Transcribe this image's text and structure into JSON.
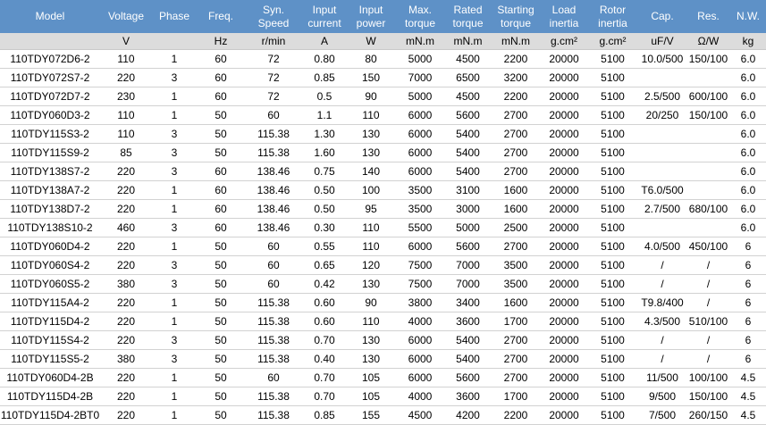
{
  "header": {
    "columns": [
      "Model",
      "Voltage",
      "Phase",
      "Freq.",
      "Syn.\nSpeed",
      "Input\ncurrent",
      "Input\npower",
      "Max.\ntorque",
      "Rated\ntorque",
      "Starting\ntorque",
      "Load\ninertia",
      "Rotor\ninertia",
      "Cap.",
      "Res.",
      "N.W."
    ],
    "units": [
      "",
      "V",
      "",
      "Hz",
      "r/min",
      "A",
      "W",
      "mN.m",
      "mN.m",
      "mN.m",
      "g.cm²",
      "g.cm²",
      "uF/V",
      "Ω/W",
      "kg"
    ]
  },
  "rows": [
    [
      "110TDY072D6-2",
      "110",
      "1",
      "60",
      "72",
      "0.80",
      "80",
      "5000",
      "4500",
      "2200",
      "20000",
      "5100",
      "10.0/500",
      "150/100",
      "6.0"
    ],
    [
      "110TDY072S7-2",
      "220",
      "3",
      "60",
      "72",
      "0.85",
      "150",
      "7000",
      "6500",
      "3200",
      "20000",
      "5100",
      "",
      "",
      "6.0"
    ],
    [
      "110TDY072D7-2",
      "230",
      "1",
      "60",
      "72",
      "0.5",
      "90",
      "5000",
      "4500",
      "2200",
      "20000",
      "5100",
      "2.5/500",
      "600/100",
      "6.0"
    ],
    [
      "110TDY060D3-2",
      "110",
      "1",
      "50",
      "60",
      "1.1",
      "110",
      "6000",
      "5600",
      "2700",
      "20000",
      "5100",
      "20/250",
      "150/100",
      "6.0"
    ],
    [
      "110TDY115S3-2",
      "110",
      "3",
      "50",
      "115.38",
      "1.30",
      "130",
      "6000",
      "5400",
      "2700",
      "20000",
      "5100",
      "",
      "",
      "6.0"
    ],
    [
      "110TDY115S9-2",
      "85",
      "3",
      "50",
      "115.38",
      "1.60",
      "130",
      "6000",
      "5400",
      "2700",
      "20000",
      "5100",
      "",
      "",
      "6.0"
    ],
    [
      "110TDY138S7-2",
      "220",
      "3",
      "60",
      "138.46",
      "0.75",
      "140",
      "6000",
      "5400",
      "2700",
      "20000",
      "5100",
      "",
      "",
      "6.0"
    ],
    [
      "110TDY138A7-2",
      "220",
      "1",
      "60",
      "138.46",
      "0.50",
      "100",
      "3500",
      "3100",
      "1600",
      "20000",
      "5100",
      "T6.0/500",
      "",
      "6.0"
    ],
    [
      "110TDY138D7-2",
      "220",
      "1",
      "60",
      "138.46",
      "0.50",
      "95",
      "3500",
      "3000",
      "1600",
      "20000",
      "5100",
      "2.7/500",
      "680/100",
      "6.0"
    ],
    [
      "110TDY138S10-2",
      "460",
      "3",
      "60",
      "138.46",
      "0.30",
      "110",
      "5500",
      "5000",
      "2500",
      "20000",
      "5100",
      "",
      "",
      "6.0"
    ],
    [
      "110TDY060D4-2",
      "220",
      "1",
      "50",
      "60",
      "0.55",
      "110",
      "6000",
      "5600",
      "2700",
      "20000",
      "5100",
      "4.0/500",
      "450/100",
      "6"
    ],
    [
      "110TDY060S4-2",
      "220",
      "3",
      "50",
      "60",
      "0.65",
      "120",
      "7500",
      "7000",
      "3500",
      "20000",
      "5100",
      "/",
      "/",
      "6"
    ],
    [
      "110TDY060S5-2",
      "380",
      "3",
      "50",
      "60",
      "0.42",
      "130",
      "7500",
      "7000",
      "3500",
      "20000",
      "5100",
      "/",
      "/",
      "6"
    ],
    [
      "110TDY115A4-2",
      "220",
      "1",
      "50",
      "115.38",
      "0.60",
      "90",
      "3800",
      "3400",
      "1600",
      "20000",
      "5100",
      "T9.8/400",
      "/",
      "6"
    ],
    [
      "110TDY115D4-2",
      "220",
      "1",
      "50",
      "115.38",
      "0.60",
      "110",
      "4000",
      "3600",
      "1700",
      "20000",
      "5100",
      "4.3/500",
      "510/100",
      "6"
    ],
    [
      "110TDY115S4-2",
      "220",
      "3",
      "50",
      "115.38",
      "0.70",
      "130",
      "6000",
      "5400",
      "2700",
      "20000",
      "5100",
      "/",
      "/",
      "6"
    ],
    [
      "110TDY115S5-2",
      "380",
      "3",
      "50",
      "115.38",
      "0.40",
      "130",
      "6000",
      "5400",
      "2700",
      "20000",
      "5100",
      "/",
      "/",
      "6"
    ],
    [
      "110TDY060D4-2B",
      "220",
      "1",
      "50",
      "60",
      "0.70",
      "105",
      "6000",
      "5600",
      "2700",
      "20000",
      "5100",
      "11/500",
      "100/100",
      "4.5"
    ],
    [
      "110TDY115D4-2B",
      "220",
      "1",
      "50",
      "115.38",
      "0.70",
      "105",
      "4000",
      "3600",
      "1700",
      "20000",
      "5100",
      "9/500",
      "150/100",
      "4.5"
    ],
    [
      "110TDY115D4-2BT0",
      "220",
      "1",
      "50",
      "115.38",
      "0.85",
      "155",
      "4500",
      "4200",
      "2200",
      "20000",
      "5100",
      "7/500",
      "260/150",
      "4.5"
    ]
  ]
}
